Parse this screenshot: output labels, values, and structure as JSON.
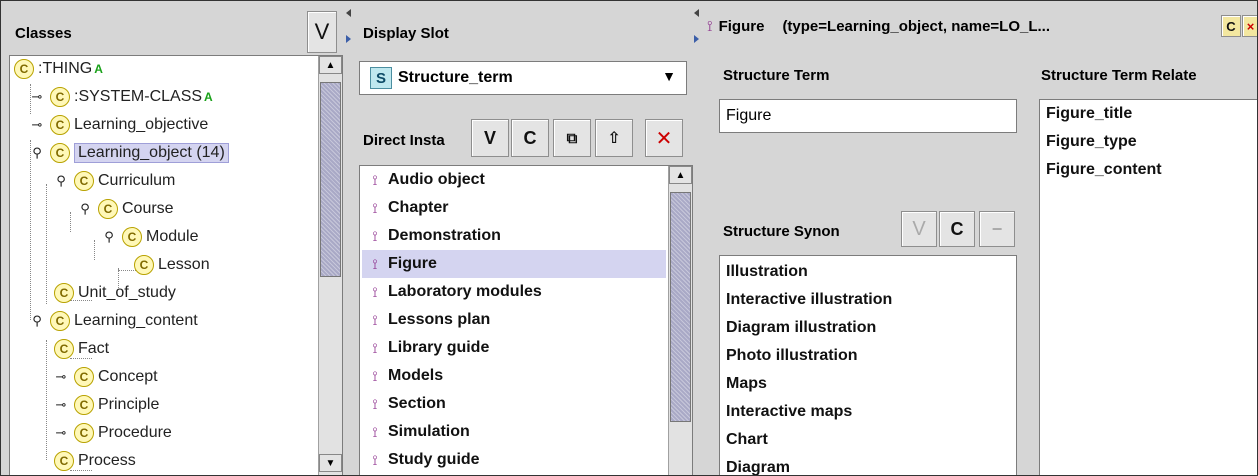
{
  "classes": {
    "header": "Classes",
    "view_button": "V",
    "items": [
      {
        "label": ":THING",
        "badge": "A",
        "toggle": ""
      },
      {
        "label": ":SYSTEM-CLASS",
        "badge": "A",
        "toggle": "o-"
      },
      {
        "label": "Learning_objective",
        "toggle": "o-"
      },
      {
        "label": "Learning_object  (14)",
        "toggle": "o|",
        "selected": true
      },
      {
        "label": "Curriculum",
        "toggle": "o|"
      },
      {
        "label": "Course",
        "toggle": "o|"
      },
      {
        "label": "Module",
        "toggle": "o|"
      },
      {
        "label": "Lesson",
        "toggle": ""
      },
      {
        "label": "Unit_of_study",
        "toggle": ""
      },
      {
        "label": "Learning_content",
        "toggle": "o|"
      },
      {
        "label": "Fact",
        "toggle": ""
      },
      {
        "label": "Concept",
        "toggle": "o-"
      },
      {
        "label": "Principle",
        "toggle": "o-"
      },
      {
        "label": "Procedure",
        "toggle": "o-"
      },
      {
        "label": "Process",
        "toggle": ""
      }
    ]
  },
  "display_slot": {
    "header": "Display Slot",
    "badge": "S",
    "value": "Structure_term"
  },
  "direct_instances": {
    "header": "Direct Insta",
    "buttons": [
      "V",
      "C",
      "⧉",
      "⇧",
      "✕"
    ],
    "items": [
      "Audio object",
      "Chapter",
      "Demonstration",
      "Figure",
      "Laboratory modules",
      "Lessons plan",
      "Library guide",
      "Models",
      "Section",
      "Simulation",
      "Study guide"
    ],
    "selected_index": 3
  },
  "instance_form": {
    "title": "Figure",
    "subtitle": "(type=Learning_object, name=LO_L...",
    "title_buttons": [
      "C",
      "×"
    ],
    "structure_term_label": "Structure Term",
    "structure_term_value": "Figure",
    "related_label": "Structure Term Relate",
    "related_items": [
      "Figure_title",
      "Figure_type",
      "Figure_content"
    ],
    "synonyms_label": "Structure Synon",
    "synonyms_buttons": [
      "V",
      "C",
      "−"
    ],
    "synonyms_items": [
      "Illustration",
      "Interactive illustration",
      "Diagram illustration",
      "Photo illustration",
      "Maps",
      "Interactive maps",
      "Chart",
      "Diagram"
    ]
  },
  "colors": {
    "selection": "#d4d4f0",
    "class_icon_fill": "#fff8b8",
    "instance_icon": "#8a2a8a",
    "badge_green": "#19a119",
    "close_red": "#cc0000"
  }
}
